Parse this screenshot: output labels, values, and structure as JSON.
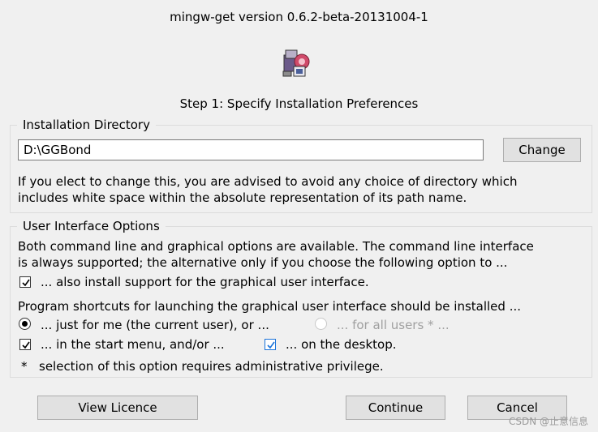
{
  "window": {
    "title": "mingw-get version 0.6.2-beta-20131004-1",
    "logo_icon": "mingw-logo-icon",
    "step": "Step 1: Specify Installation Preferences"
  },
  "install_dir": {
    "legend": "Installation Directory",
    "value": "D:\\GGBond",
    "change_label": "Change",
    "note_line1": "If you elect to change this, you are advised to avoid any choice of directory which",
    "note_line2": "includes white space within the absolute representation of its path name."
  },
  "ui_options": {
    "legend": "User Interface Options",
    "desc_line1": "Both command line and graphical options are available.  The command line interface",
    "desc_line2": "is always supported; the alternative only if you choose the following option to ...",
    "gui_support_label": "... also install support for the graphical user interface.",
    "gui_support_checked": true,
    "shortcuts_heading": "Program shortcuts for launching the graphical user interface should be installed ...",
    "just_me_label": "... just for me (the current user), or ...",
    "just_me_selected": true,
    "all_users_label": "... for all users * ...",
    "all_users_enabled": false,
    "start_menu_label": "... in the start menu, and/or ...",
    "start_menu_checked": true,
    "desktop_label": "... on the desktop.",
    "desktop_checked": true,
    "footnote_mark": "*",
    "footnote": "selection of this option requires administrative privilege."
  },
  "buttons": {
    "view_licence": "View Licence",
    "continue": "Continue",
    "cancel": "Cancel"
  },
  "watermark": "CSDN @止意信息",
  "colors": {
    "background": "#f0f0f0",
    "checkbox_accent": "#1a73d9",
    "disabled_text": "#a0a0a0"
  }
}
